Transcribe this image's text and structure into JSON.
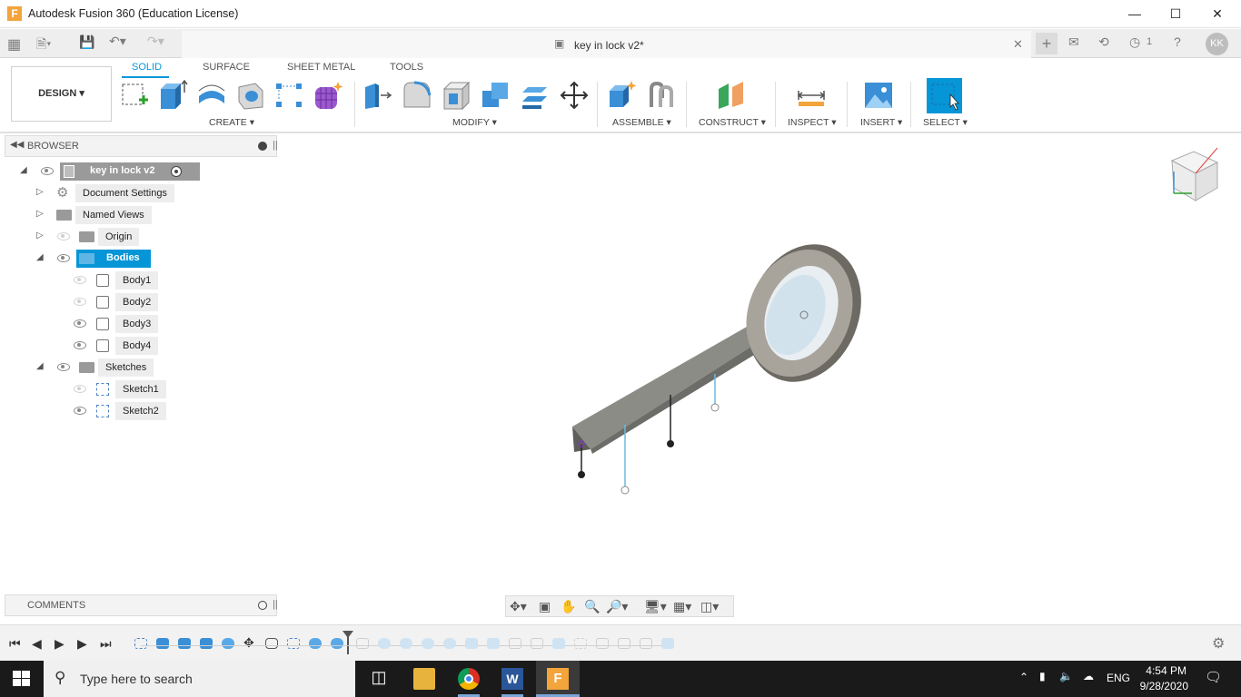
{
  "window": {
    "title": "Autodesk Fusion 360 (Education License)",
    "app_icon": "F"
  },
  "document": {
    "tab_title": "key in lock v2*",
    "jobs_count": "1",
    "user_initials": "KK"
  },
  "toolbar": {
    "tabs": [
      "SOLID",
      "SURFACE",
      "SHEET METAL",
      "TOOLS"
    ],
    "workspace": "DESIGN",
    "groups": {
      "create": "CREATE",
      "modify": "MODIFY",
      "assemble": "ASSEMBLE",
      "construct": "CONSTRUCT",
      "inspect": "INSPECT",
      "insert": "INSERT",
      "select": "SELECT"
    }
  },
  "browser": {
    "header": "BROWSER",
    "root": "key in lock v2",
    "items": {
      "document_settings": "Document Settings",
      "named_views": "Named Views",
      "origin": "Origin",
      "bodies": "Bodies",
      "body1": "Body1",
      "body2": "Body2",
      "body3": "Body3",
      "body4": "Body4",
      "sketches": "Sketches",
      "sketch1": "Sketch1",
      "sketch2": "Sketch2"
    }
  },
  "comments": {
    "header": "COMMENTS"
  },
  "taskbar": {
    "search_placeholder": "Type here to search",
    "language": "ENG",
    "time": "4:54 PM",
    "date": "9/28/2020"
  },
  "colors": {
    "accent": "#0696d7",
    "selected": "#0696d7",
    "model": "#7a7a74"
  }
}
